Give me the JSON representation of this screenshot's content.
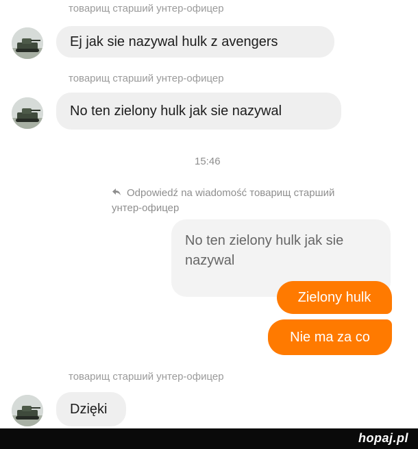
{
  "messages": {
    "sender_name": "товарищ старший унтер-офицер",
    "msg1": "Ej jak sie nazywal hulk z avengers",
    "msg2": "No ten zielony hulk jak sie nazywal",
    "timestamp": "15:46",
    "reply_header": "Odpowiedź na wiadomość товарищ старший унтер-офицер",
    "quoted_text": "No ten zielony hulk jak sie nazywal",
    "out1": "Zielony hulk",
    "out2": "Nie ma za co",
    "msg3": "Dzięki"
  },
  "footer": {
    "brand": "hopaj.pl"
  },
  "colors": {
    "outgoing_bubble": "#ff7a00",
    "incoming_bubble": "#efefef",
    "brand_text": "#ffffff"
  },
  "icons": {
    "avatar": "tank-photo-avatar",
    "reply": "reply-arrow-icon"
  }
}
